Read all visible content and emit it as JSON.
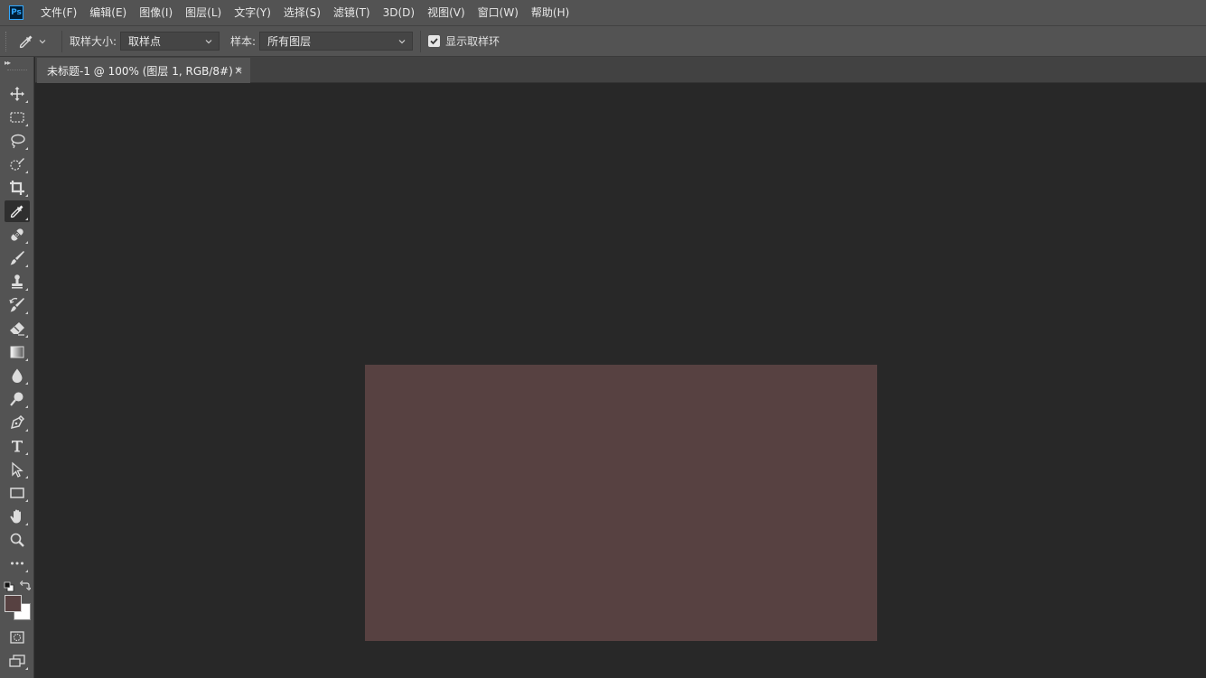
{
  "app": {
    "logo_text": "Ps"
  },
  "menu": {
    "items": [
      "文件(F)",
      "编辑(E)",
      "图像(I)",
      "图层(L)",
      "文字(Y)",
      "选择(S)",
      "滤镜(T)",
      "3D(D)",
      "视图(V)",
      "窗口(W)",
      "帮助(H)"
    ]
  },
  "options": {
    "sample_size_label": "取样大小:",
    "sample_size_value": "取样点",
    "sample_label": "样本:",
    "sample_value": "所有图层",
    "show_ring_label": "显示取样环",
    "show_ring_checked": true
  },
  "document": {
    "tab_title": "未标题-1 @ 100% (图层 1, RGB/8#) *",
    "close_glyph": "×",
    "canvas_color": "#574141"
  },
  "colors": {
    "foreground": "#574141",
    "background": "#ffffff",
    "ui_bar": "#535353",
    "workspace": "#282828"
  },
  "tools": [
    "move-tool",
    "marquee-tool",
    "lasso-tool",
    "quick-selection-tool",
    "crop-tool",
    "eyedropper-tool",
    "healing-brush-tool",
    "brush-tool",
    "clone-stamp-tool",
    "history-brush-tool",
    "eraser-tool",
    "gradient-tool",
    "blur-tool",
    "dodge-tool",
    "pen-tool",
    "type-tool",
    "path-selection-tool",
    "rectangle-tool",
    "hand-tool",
    "zoom-tool",
    "more-tools",
    "quick-mask-mode",
    "screen-mode"
  ],
  "active_tool": "eyedropper-tool"
}
